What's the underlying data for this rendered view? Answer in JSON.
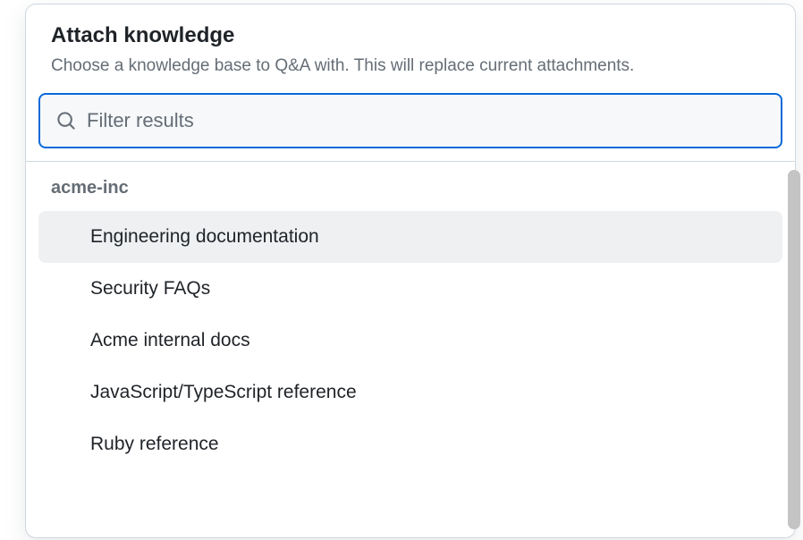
{
  "dialog": {
    "title": "Attach knowledge",
    "subtitle": "Choose a knowledge base to Q&A with. This will replace current attachments."
  },
  "search": {
    "placeholder": "Filter results",
    "value": ""
  },
  "group": {
    "label": "acme-inc"
  },
  "items": [
    {
      "label": "Engineering documentation",
      "selected": true
    },
    {
      "label": "Security FAQs",
      "selected": false
    },
    {
      "label": "Acme internal docs",
      "selected": false
    },
    {
      "label": "JavaScript/TypeScript reference",
      "selected": false
    },
    {
      "label": "Ruby reference",
      "selected": false
    }
  ]
}
